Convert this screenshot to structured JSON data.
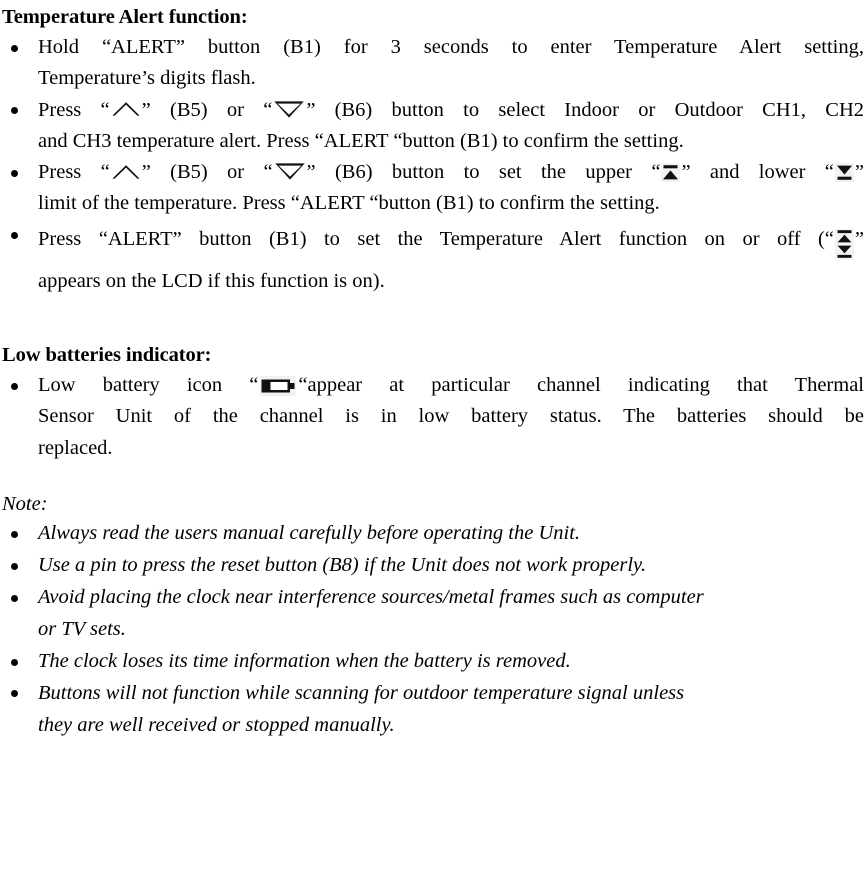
{
  "document": {
    "sections": [
      {
        "id": "temperature-alert",
        "heading": "Temperature Alert function:",
        "bullets": [
          {
            "lines": [
              "Hold “ALERT” button (B1) for 3 seconds to enter Temperature Alert setting,",
              "Temperature’s digits flash."
            ]
          },
          {
            "lines": [
              "Press “[up-triangle]” (B5) or “[down-triangle]” (B6) button to select Indoor or Outdoor CH1, CH2",
              "and CH3 temperature alert. Press “ALERT “button (B1) to confirm the setting."
            ],
            "line1_parts": {
              "a": "Press “",
              "b": "” (B5) or “",
              "c": "” (B6) button to select Indoor or Outdoor CH1, CH2"
            },
            "line2": "and CH3 temperature alert. Press “ALERT “button (B1) to confirm the setting."
          },
          {
            "lines": [
              "Press “[up-triangle]” (B5) or “[down-triangle]” (B6) button to set the upper “[upper-limit]” and lower “[lower-limit]”",
              "limit of the temperature. Press “ALERT “button (B1) to confirm the setting."
            ],
            "line1_parts": {
              "a": "Press “",
              "b": "” (B5) or “",
              "c": "” (B6) button to set the upper “",
              "d": "” and lower “",
              "e": "”"
            },
            "line2": "limit of the temperature. Press “ALERT “button (B1) to confirm the setting."
          },
          {
            "lines": [
              "Press “ALERT” button (B1) to set the Temperature Alert function on or off (“[alert-toggle]”",
              "appears on the LCD if this function is on)."
            ],
            "line1_parts": {
              "a": "Press “ALERT” button (B1) to set the Temperature Alert function on or off (“",
              "b": "”"
            },
            "line2": "appears on the LCD if this function is on)."
          }
        ]
      },
      {
        "id": "low-batteries",
        "heading": "Low batteries indicator:",
        "bullets": [
          {
            "line1_parts": {
              "a": "Low battery icon “",
              "b": "“appear at particular channel indicating that Thermal"
            },
            "line2": "Sensor Unit of the channel is in low battery status. The batteries should be",
            "line3": "replaced."
          }
        ]
      },
      {
        "id": "note",
        "heading": "Note:",
        "bullets": [
          {
            "line1": "Always read the users manual carefully before operating the Unit."
          },
          {
            "line1": "Use a pin to press the reset button (B8) if the Unit does not work properly."
          },
          {
            "line1": "Avoid placing the clock near interference sources/metal frames such as computer",
            "line2": "or TV sets."
          },
          {
            "line1": "The clock loses its time information when the battery is removed."
          },
          {
            "line1": "Buttons will not function while scanning for outdoor temperature signal unless",
            "line2": "they are well received or stopped manually."
          }
        ]
      }
    ],
    "icons": {
      "up_triangle": "triangle-up-outline-icon",
      "down_triangle": "triangle-down-outline-icon",
      "upper_limit": "upper-limit-icon",
      "lower_limit": "lower-limit-icon",
      "alert_toggle": "alert-toggle-icon",
      "battery": "low-battery-icon"
    },
    "colors": {
      "text": "#000000",
      "background": "#ffffff",
      "icon_backdrop": "#f2f2f2"
    }
  }
}
